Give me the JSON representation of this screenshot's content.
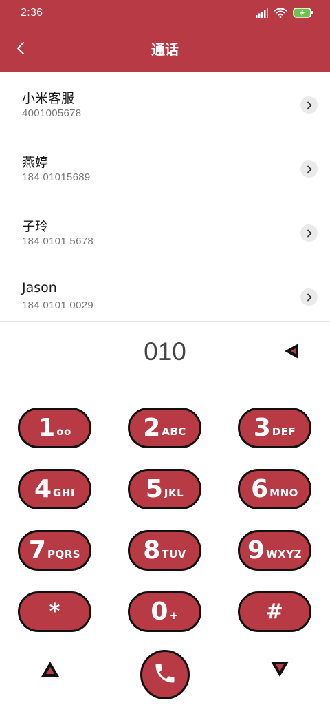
{
  "status_bar": {
    "time": "2:36"
  },
  "app_bar": {
    "title": "通话"
  },
  "contacts": [
    {
      "name": "小米客服",
      "number": "4001005678"
    },
    {
      "name": "燕婷",
      "number": "184 01015689"
    },
    {
      "name": "子玲",
      "number": "184 0101 5678"
    },
    {
      "name": "Jason",
      "number": "184 0101 0029"
    }
  ],
  "dialer": {
    "input": "010",
    "keys": [
      {
        "digit": "1",
        "letters": "oo"
      },
      {
        "digit": "2",
        "letters": "ABC"
      },
      {
        "digit": "3",
        "letters": "DEF"
      },
      {
        "digit": "4",
        "letters": "GHI"
      },
      {
        "digit": "5",
        "letters": "JKL"
      },
      {
        "digit": "6",
        "letters": "MNO"
      },
      {
        "digit": "7",
        "letters": "PQRS"
      },
      {
        "digit": "8",
        "letters": "TUV"
      },
      {
        "digit": "9",
        "letters": "WXYZ"
      },
      {
        "digit": "*",
        "letters": ""
      },
      {
        "digit": "0",
        "letters": "+"
      },
      {
        "digit": "#",
        "letters": ""
      }
    ]
  },
  "colors": {
    "accent": "#b83a44",
    "outline": "#111111",
    "background": "#ffffff"
  },
  "icons": {
    "back": "chevron-left-icon",
    "contact_action": "chevron-right-icon",
    "backspace": "backspace-triangle-icon",
    "up": "triangle-up-icon",
    "down": "triangle-down-icon",
    "call": "phone-icon"
  }
}
